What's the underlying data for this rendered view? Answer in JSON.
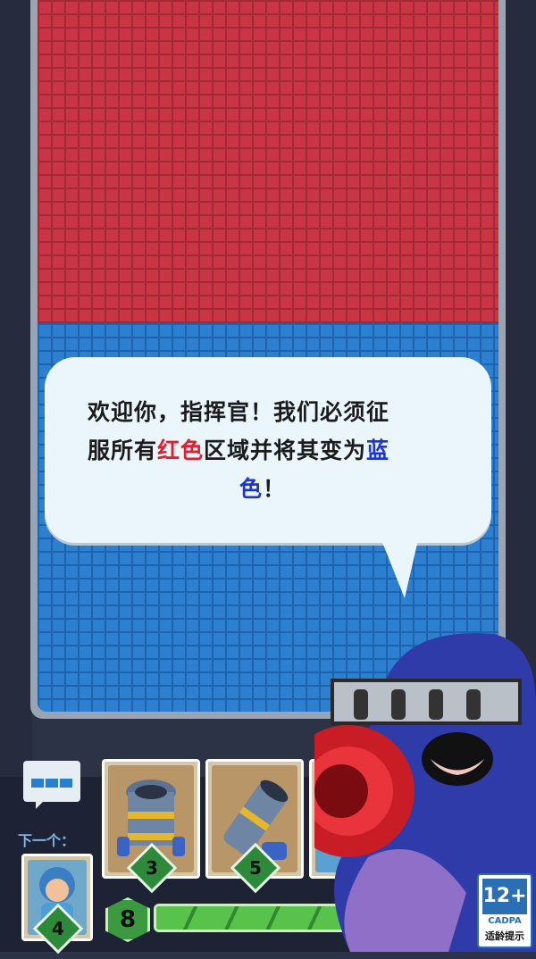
{
  "dialog": {
    "line1": "欢迎你，指挥官！我们必须征",
    "line2_pre": "服所有",
    "line2_red": "红色",
    "line2_mid": "区域并将其变为",
    "line2_blue": "蓝",
    "line3_blue": "色",
    "line3_post": "！"
  },
  "next_label": "下一个：",
  "cards": [
    {
      "name": "cannon-tower-card",
      "cost": "3"
    },
    {
      "name": "cannon-card",
      "cost": "5"
    }
  ],
  "next_card": {
    "cost": "4"
  },
  "elixir": {
    "value": "8",
    "fill_fraction": 0.75
  },
  "age_rating": {
    "top": "12+",
    "middle": "CADPA",
    "bottom": "适龄提示"
  },
  "colors": {
    "red_zone": "#c83545",
    "blue_zone": "#2d7fd0",
    "accent_green": "#3b9a3f"
  },
  "icons": [
    "chat-bubble-icon",
    "cannon-tower-icon",
    "cannon-icon",
    "hero-portrait-icon",
    "knight-character-icon"
  ]
}
